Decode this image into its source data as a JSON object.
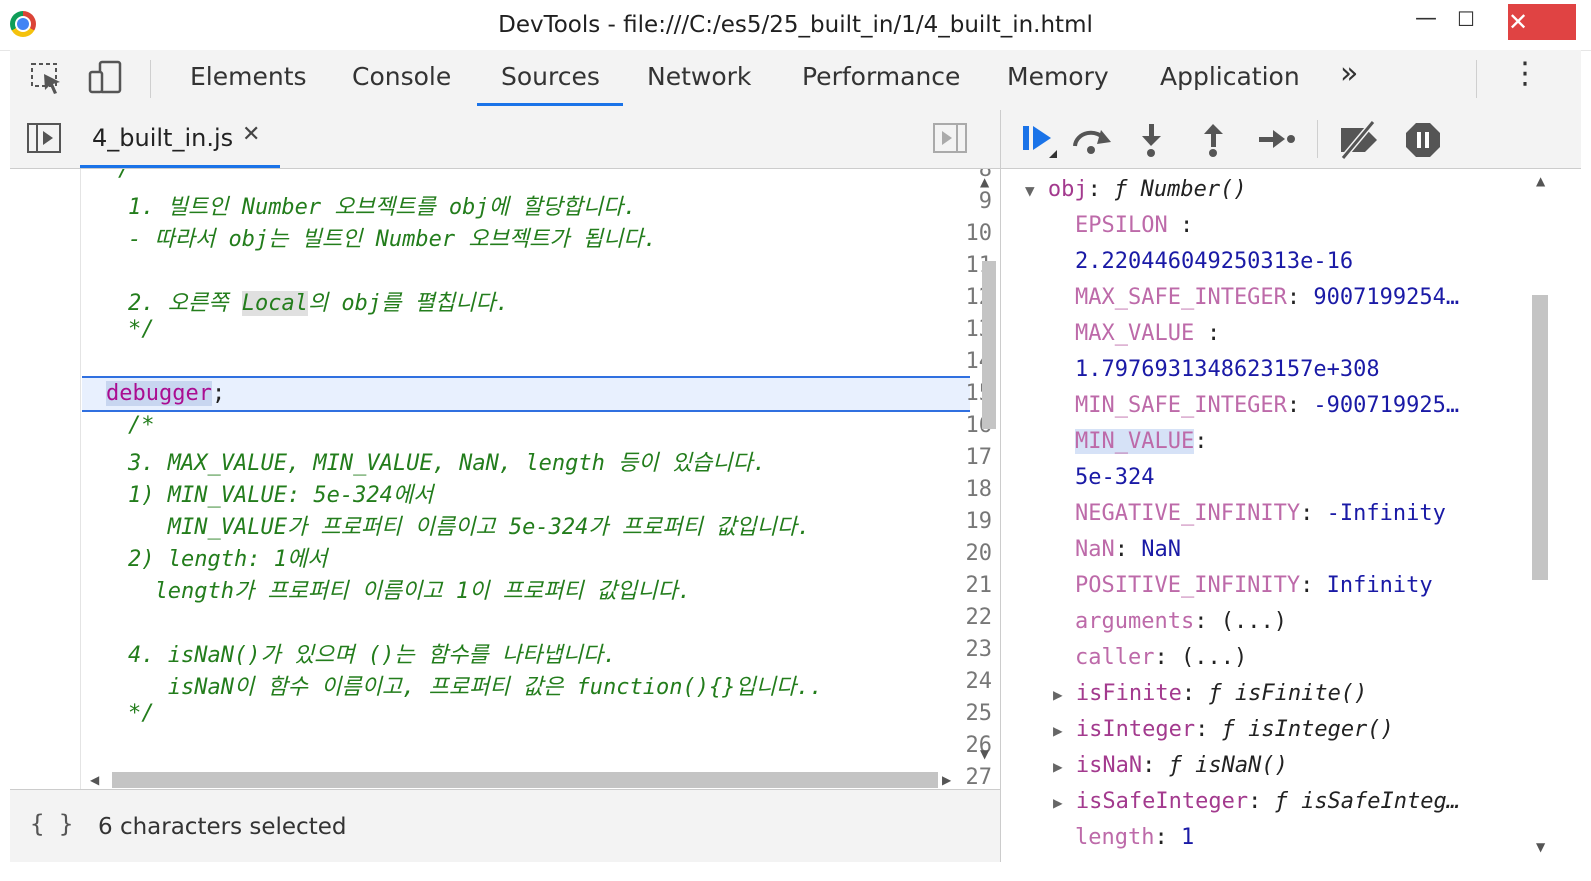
{
  "window": {
    "title": "DevTools - file:///C:/es5/25_built_in/1/4_built_in.html",
    "minimize": "—",
    "maximize": "☐",
    "close": "✕"
  },
  "tabs": [
    "Elements",
    "Console",
    "Sources",
    "Network",
    "Performance",
    "Memory",
    "Application"
  ],
  "active_tab": "Sources",
  "more_tabs": "»",
  "menu": "⋮",
  "file_tab": {
    "name": "4_built_in.js",
    "close": "✕"
  },
  "editor": {
    "lines": [
      {
        "n": "8",
        "t": "/"
      },
      {
        "n": "9",
        "t": "1. 빌트인 Number 오브젝트를 obj에 할당합니다."
      },
      {
        "n": "10",
        "t": "- 따라서 obj는 빌트인 Number 오브젝트가 됩니다."
      },
      {
        "n": "11",
        "t": ""
      },
      {
        "n": "12",
        "t_pre": "2. 오른쪽 ",
        "t_hl": "Local",
        "t_post": "의 obj를 펼칩니다."
      },
      {
        "n": "13",
        "t": "*/"
      },
      {
        "n": "14",
        "t": ""
      },
      {
        "n": "15",
        "kw": "debugger",
        "rest": ";"
      },
      {
        "n": "16",
        "t": "/*"
      },
      {
        "n": "17",
        "t": "3. MAX_VALUE, MIN_VALUE, NaN, length 등이 있습니다."
      },
      {
        "n": "18",
        "t": "1) MIN_VALUE: 5e-324에서"
      },
      {
        "n": "19",
        "t": "   MIN_VALUE가 프로퍼티 이름이고 5e-324가 프로퍼티 값입니다."
      },
      {
        "n": "20",
        "t": "2) length: 1에서"
      },
      {
        "n": "21",
        "t": "  length가 프로퍼티 이름이고 1이 프로퍼티 값입니다."
      },
      {
        "n": "22",
        "t": ""
      },
      {
        "n": "23",
        "t": "4. isNaN()가 있으며 ()는 함수를 나타냅니다."
      },
      {
        "n": "24",
        "t": "   isNaN이 함수 이름이고, 프로퍼티 값은 function(){}입니다.."
      },
      {
        "n": "25",
        "t": "*/"
      },
      {
        "n": "26",
        "t": ""
      },
      {
        "n": "27",
        "t": ". ."
      }
    ]
  },
  "status": {
    "icon": "{ }",
    "text": "6 characters selected"
  },
  "scope": {
    "root_key": "obj",
    "root_val": "ƒ Number()",
    "rows": [
      {
        "k": "EPSILON",
        "v": ""
      },
      {
        "k": "",
        "v": "2.220446049250313e-16"
      },
      {
        "k": "MAX_SAFE_INTEGER",
        "v": "9007199254…"
      },
      {
        "k": "MAX_VALUE",
        "v": ""
      },
      {
        "k": "",
        "v": "1.7976931348623157e+308"
      },
      {
        "k": "MIN_SAFE_INTEGER",
        "v": "-900719925…"
      },
      {
        "k": "MIN_VALUE",
        "v": ""
      },
      {
        "k": "",
        "v": "5e-324"
      },
      {
        "k": "NEGATIVE_INFINITY",
        "v": "-Infinity"
      },
      {
        "k": "NaN",
        "v": "NaN"
      },
      {
        "k": "POSITIVE_INFINITY",
        "v": "Infinity"
      },
      {
        "k": "arguments",
        "v": "(...)"
      },
      {
        "k": "caller",
        "v": "(...)"
      }
    ],
    "fn_rows": [
      {
        "k": "isFinite",
        "v": "ƒ isFinite()"
      },
      {
        "k": "isInteger",
        "v": "ƒ isInteger()"
      },
      {
        "k": "isNaN",
        "v": "ƒ isNaN()"
      },
      {
        "k": "isSafeInteger",
        "v": "ƒ isSafeInteg…"
      }
    ],
    "last_row": {
      "k": "length",
      "v": "1"
    }
  },
  "colors": {
    "accent": "#1a73e8",
    "comment": "#237d1c",
    "keyword": "#aa0d91",
    "prop": "#a33a8e",
    "number": "#1a1aa6"
  }
}
